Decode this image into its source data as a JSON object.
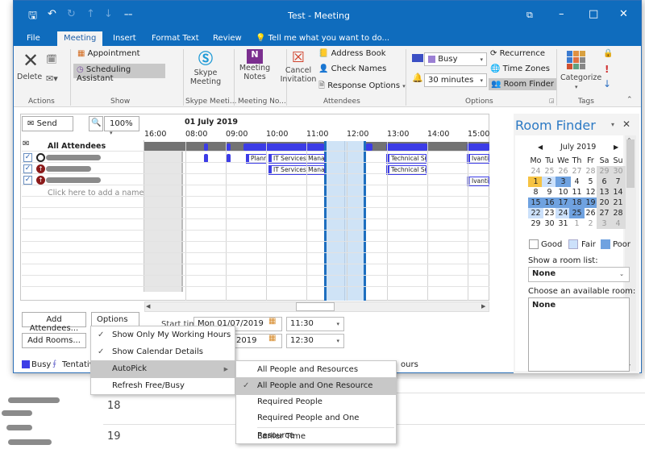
{
  "window": {
    "title": "Test - Meeting",
    "tabs": [
      "File",
      "Meeting",
      "Insert",
      "Format Text",
      "Review"
    ],
    "active_tab": "Meeting",
    "tell_me": "Tell me what you want to do..."
  },
  "ribbon": {
    "actions": {
      "delete": "Delete",
      "group": "Actions"
    },
    "show": {
      "appointment": "Appointment",
      "scheduling_assistant": "Scheduling Assistant",
      "group": "Show"
    },
    "skype": {
      "label1": "Skype",
      "label2": "Meeting",
      "group": "Skype Meeti..."
    },
    "notes": {
      "label1": "Meeting",
      "label2": "Notes",
      "group": "Meeting No..."
    },
    "attendees": {
      "cancel1": "Cancel",
      "cancel2": "Invitation",
      "address_book": "Address Book",
      "check_names": "Check Names",
      "response_options": "Response Options",
      "group": "Attendees"
    },
    "options": {
      "show_as": "Busy",
      "show_as_color": "#9b7fd4",
      "reminder": "30 minutes",
      "recurrence": "Recurrence",
      "time_zones": "Time Zones",
      "room_finder": "Room Finder",
      "group": "Options"
    },
    "tags": {
      "categorize": "Categorize",
      "group": "Tags"
    }
  },
  "scheduling": {
    "send": "Send",
    "zoom": "100%",
    "date_header": "01 July 2019",
    "hours": [
      "16:00",
      "08:00",
      "09:00",
      "10:00",
      "11:00",
      "12:00",
      "13:00",
      "14:00",
      "15:00"
    ],
    "all_attendees": "All Attendees",
    "add_name_placeholder": "Click here to add a name",
    "events": {
      "plan": "Planr",
      "itsm1": "IT Services Manager",
      "itsm2": "IT Services Manager",
      "tech1": "Technical Su",
      "tech2": "Technical Su",
      "ivanti1": "Ivanti I",
      "ivanti2": "Ivanti I"
    },
    "add_attendees": "Add Attendees...",
    "options_btn": "Options",
    "add_rooms": "Add Rooms...",
    "start_label": "Start time",
    "start_date": "Mon 01/07/2019",
    "start_time": "11:30",
    "end_date": "2019",
    "end_time": "12:30",
    "legend_busy": "Busy",
    "legend_tentative": "Tentative",
    "legend_hours_tail": "ours"
  },
  "room_finder": {
    "title": "Room Finder",
    "month": "July 2019",
    "weekdays": [
      "Mo",
      "Tu",
      "We",
      "Th",
      "Fr",
      "Sa",
      "Su"
    ],
    "weeks": [
      [
        "24",
        "25",
        "26",
        "27",
        "28",
        "29",
        "30"
      ],
      [
        "1",
        "2",
        "3",
        "4",
        "5",
        "6",
        "7"
      ],
      [
        "8",
        "9",
        "10",
        "11",
        "12",
        "13",
        "14"
      ],
      [
        "15",
        "16",
        "17",
        "18",
        "19",
        "20",
        "21"
      ],
      [
        "22",
        "23",
        "24",
        "25",
        "26",
        "27",
        "28"
      ],
      [
        "29",
        "30",
        "31",
        "1",
        "2",
        "3",
        "4"
      ]
    ],
    "legend": {
      "good": "Good",
      "fair": "Fair",
      "poor": "Poor"
    },
    "room_list_label": "Show a room list:",
    "room_list_value": "None",
    "available_label": "Choose an available room:",
    "available_value": "None"
  },
  "options_menu": {
    "items": [
      "Show Only My Working Hours",
      "Show Calendar Details",
      "AutoPick",
      "Refresh Free/Busy"
    ],
    "checked": [
      true,
      true,
      false,
      false
    ]
  },
  "autopick_menu": {
    "items": [
      "All People and Resources",
      "All People and One Resource",
      "Required People",
      "Required People and One Resource",
      "Earlier Time"
    ],
    "selected": "All People and One Resource"
  },
  "background": {
    "rows": [
      "18",
      "19"
    ]
  }
}
